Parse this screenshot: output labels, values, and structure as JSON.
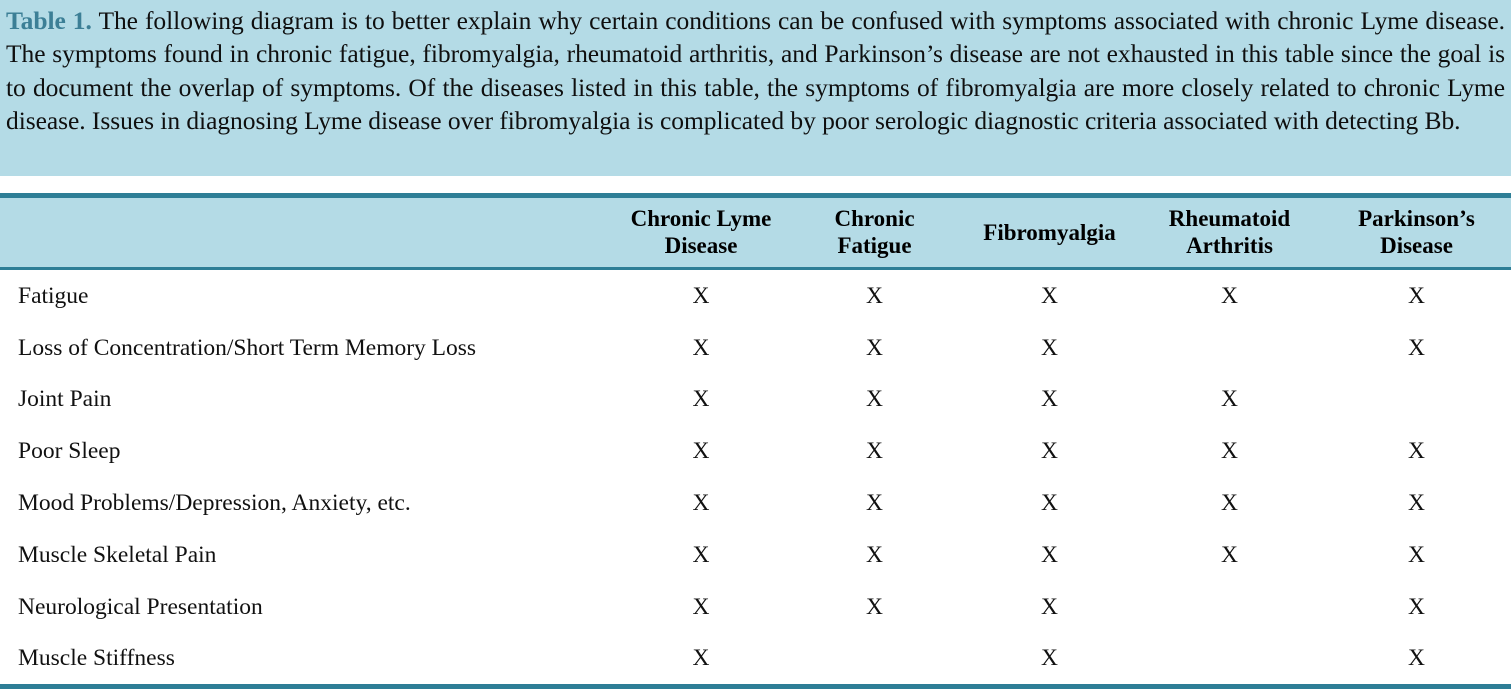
{
  "caption": {
    "label": "Table 1.",
    "body": " The following diagram is to better explain why certain conditions can be confused with symptoms associated with chronic Lyme disease. The symptoms found in chronic fatigue, fibromyalgia, rheumatoid arthritis, and Parkinson’s disease are not exhausted in this table since the goal is to document the overlap of symptoms. Of the diseases listed in this table, the symptoms of fibromyalgia are more closely related to chronic Lyme disease. Issues in diagnosing Lyme disease over fibromyalgia is complicated by poor serologic diagnostic criteria associated with detecting Bb."
  },
  "colors": {
    "caption_background": "#b4dbe6",
    "header_background": "#b4dbe6",
    "rule": "#2e7e96",
    "label_accent": "#3c7f96",
    "text": "#111111",
    "body_background": "#ffffff"
  },
  "chart_data": {
    "type": "table",
    "title": "Table 1. Overlap of symptoms among chronic Lyme disease, chronic fatigue, fibromyalgia, rheumatoid arthritis, and Parkinson’s disease",
    "mark_symbol": "X",
    "row_header_label": "",
    "categories": [
      "Chronic Lyme Disease",
      "Chronic Fatigue",
      "Fibromyalgia",
      "Rheumatoid Arthritis",
      "Parkinson’s Disease"
    ],
    "column_headers": [
      {
        "line1": "Chronic Lyme",
        "line2": "Disease"
      },
      {
        "line1": "Chronic",
        "line2": "Fatigue"
      },
      {
        "line1": "Fibromyalgia",
        "line2": ""
      },
      {
        "line1": "Rheumatoid",
        "line2": "Arthritis"
      },
      {
        "line1": "Parkinson’s",
        "line2": "Disease"
      }
    ],
    "rows": [
      {
        "symptom": "Fatigue",
        "marks": [
          "X",
          "X",
          "X",
          "X",
          "X"
        ]
      },
      {
        "symptom": "Loss of Concentration/Short Term Memory Loss",
        "marks": [
          "X",
          "X",
          "X",
          "",
          "X"
        ]
      },
      {
        "symptom": "Joint Pain",
        "marks": [
          "X",
          "X",
          "X",
          "X",
          ""
        ]
      },
      {
        "symptom": "Poor Sleep",
        "marks": [
          "X",
          "X",
          "X",
          "X",
          "X"
        ]
      },
      {
        "symptom": "Mood Problems/Depression, Anxiety, etc.",
        "marks": [
          "X",
          "X",
          "X",
          "X",
          "X"
        ]
      },
      {
        "symptom": "Muscle Skeletal Pain",
        "marks": [
          "X",
          "X",
          "X",
          "X",
          "X"
        ]
      },
      {
        "symptom": "Neurological Presentation",
        "marks": [
          "X",
          "X",
          "X",
          "",
          "X"
        ]
      },
      {
        "symptom": "Muscle Stiffness",
        "marks": [
          "X",
          "",
          "X",
          "",
          "X"
        ]
      }
    ]
  }
}
